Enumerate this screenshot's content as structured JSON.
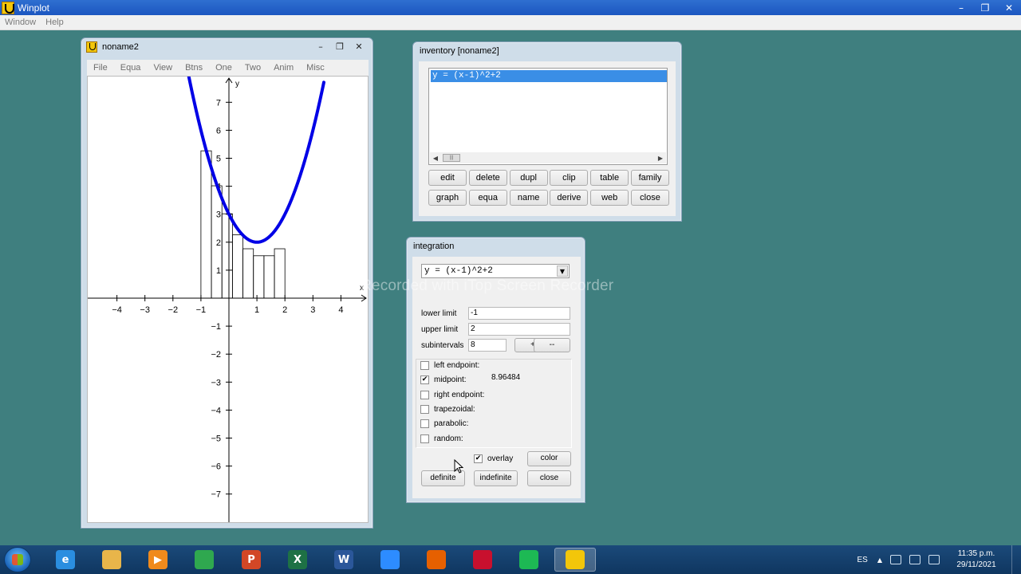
{
  "app": {
    "title": "Winplot",
    "menu": [
      "Window",
      "Help"
    ],
    "controls": {
      "minimize": "–",
      "restore": "❐",
      "close": "✕"
    }
  },
  "graph_window": {
    "title": "noname2",
    "menu": [
      "File",
      "Equa",
      "View",
      "Btns",
      "One",
      "Two",
      "Anim",
      "Misc"
    ],
    "controls": {
      "minimize": "–",
      "restore": "❐",
      "close": "✕"
    },
    "axis_labels": {
      "x": "x",
      "y": "y"
    },
    "curve_color": "#0000e6"
  },
  "chart_data": {
    "type": "line",
    "title": "",
    "xlabel": "x",
    "ylabel": "y",
    "xlim": [
      -5,
      5
    ],
    "ylim": [
      -8,
      8
    ],
    "x_ticks": [
      -4,
      -3,
      -2,
      -1,
      1,
      2,
      3,
      4
    ],
    "y_ticks": [
      -7,
      -6,
      -5,
      -4,
      -3,
      -2,
      -1,
      1,
      2,
      3,
      4,
      5,
      6,
      7
    ],
    "series": [
      {
        "equation": "y = (x-1)^2+2",
        "color": "#0000e6"
      }
    ],
    "midpoint_rectangles": {
      "lower": -1,
      "upper": 2,
      "n": 8,
      "heights": [
        5.2656,
        4.0156,
        3.0156,
        2.2656,
        1.7656,
        1.5156,
        1.5156,
        1.7656
      ]
    }
  },
  "inventory": {
    "title": "inventory [noname2]",
    "items": [
      "y = (x-1)^2+2"
    ],
    "scroll_thumb": "|||",
    "buttons": [
      "edit",
      "delete",
      "dupl",
      "clip",
      "table",
      "family",
      "graph",
      "equa",
      "name",
      "derive",
      "web",
      "close"
    ]
  },
  "integration": {
    "title": "integration",
    "function": "y = (x-1)^2+2",
    "lower_label": "lower limit",
    "lower_value": "-1",
    "upper_label": "upper limit",
    "upper_value": "2",
    "subintervals_label": "subintervals",
    "subintervals_value": "8",
    "plus_label": "+",
    "minus_label": "--",
    "methods": [
      {
        "label": "left endpoint:",
        "checked": false,
        "value": ""
      },
      {
        "label": "midpoint:",
        "checked": true,
        "value": "8.96484"
      },
      {
        "label": "right endpoint:",
        "checked": false,
        "value": ""
      },
      {
        "label": "trapezoidal:",
        "checked": false,
        "value": ""
      },
      {
        "label": "parabolic:",
        "checked": false,
        "value": ""
      },
      {
        "label": "random:",
        "checked": false,
        "value": ""
      }
    ],
    "overlay_label": "overlay",
    "overlay_checked": true,
    "color_label": "color",
    "definite_label": "definite",
    "indefinite_label": "indefinite",
    "close_label": "close"
  },
  "watermark": "Recorded with iTop Screen Recorder",
  "taskbar": {
    "language": "ES",
    "time": "11:35 p.m.",
    "date": "29/11/2021",
    "apps": [
      {
        "name": "internet-explorer-icon",
        "glyph": "e",
        "color": "#2a8ee0"
      },
      {
        "name": "file-explorer-icon",
        "glyph": "",
        "color": "#e8b54a"
      },
      {
        "name": "media-player-icon",
        "glyph": "▶",
        "color": "#f08a1c"
      },
      {
        "name": "chrome-icon",
        "glyph": "",
        "color": "#2fa84f"
      },
      {
        "name": "powerpoint-icon",
        "glyph": "P",
        "color": "#d24726"
      },
      {
        "name": "excel-icon",
        "glyph": "X",
        "color": "#1e7145"
      },
      {
        "name": "word-icon",
        "glyph": "W",
        "color": "#2b579a"
      },
      {
        "name": "zoom-icon",
        "glyph": "",
        "color": "#2d8cff"
      },
      {
        "name": "firefox-icon",
        "glyph": "",
        "color": "#e66000"
      },
      {
        "name": "screen-recorder-icon",
        "glyph": "",
        "color": "#c8102e"
      },
      {
        "name": "spotify-icon",
        "glyph": "",
        "color": "#1db954"
      },
      {
        "name": "winplot-icon",
        "glyph": "",
        "color": "#f3c60a"
      }
    ]
  }
}
